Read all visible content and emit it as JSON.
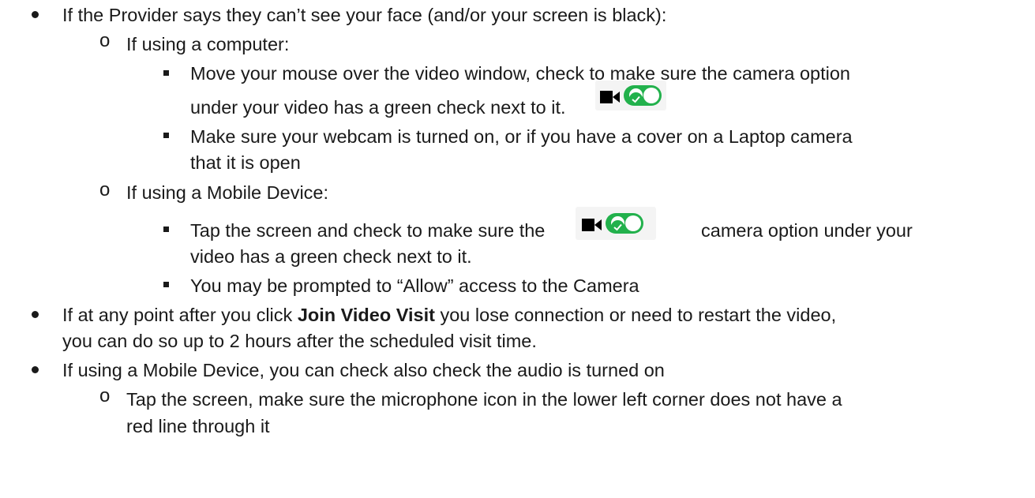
{
  "items": [
    {
      "text": "If the Provider says they can’t see your face (and/or your screen is black):"
    },
    {
      "text": "If using a computer:"
    },
    {
      "text": "Move your mouse over the video window, check to make sure the camera option"
    },
    {
      "text": "under your video has a green check next to it."
    },
    {
      "text": "Make sure your webcam is turned on, or if you have a cover on a Laptop camera"
    },
    {
      "text": "that it is open"
    },
    {
      "text": "If using a Mobile Device:"
    },
    {
      "text_before": "Tap the screen and check to make sure the",
      "text_after": "camera option under your"
    },
    {
      "text": "video has a green check next to it."
    },
    {
      "text": "You may be prompted to “Allow” access to the Camera"
    },
    {
      "text_before": "If at any point after you click ",
      "bold": "Join Video Visit",
      "text_after": " you lose connection or need to restart the video,"
    },
    {
      "text": "you can do so up to 2 hours after the scheduled visit time."
    },
    {
      "text": "If using a Mobile Device, you can check also check the audio is turned on"
    },
    {
      "text": "Tap the screen, make sure the microphone icon in the lower left corner does not have a"
    },
    {
      "text": "red line through it"
    }
  ],
  "bullets": {
    "level2": "o"
  },
  "colors": {
    "toggle_green": "#22b14c",
    "icon_bg": "#f4f4f4",
    "text": "#1a1a1a"
  },
  "icons": {
    "camera": "video-camera-icon",
    "toggle": "camera-toggle-on-icon"
  }
}
